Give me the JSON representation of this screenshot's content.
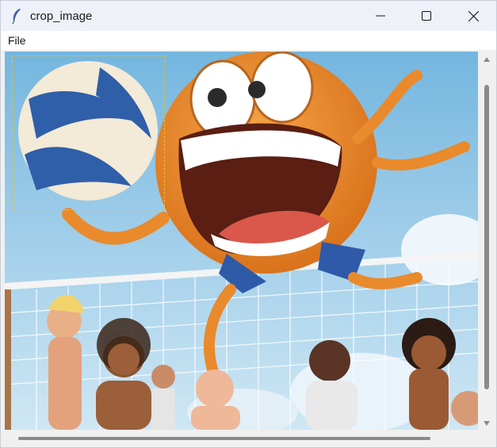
{
  "window": {
    "title": "crop_image"
  },
  "menu": {
    "items": [
      "File"
    ]
  },
  "colors": {
    "selection_dash": "#c84b2a",
    "titlebar": "#eef1f8",
    "scroll_thumb": "#8a8a8a"
  }
}
